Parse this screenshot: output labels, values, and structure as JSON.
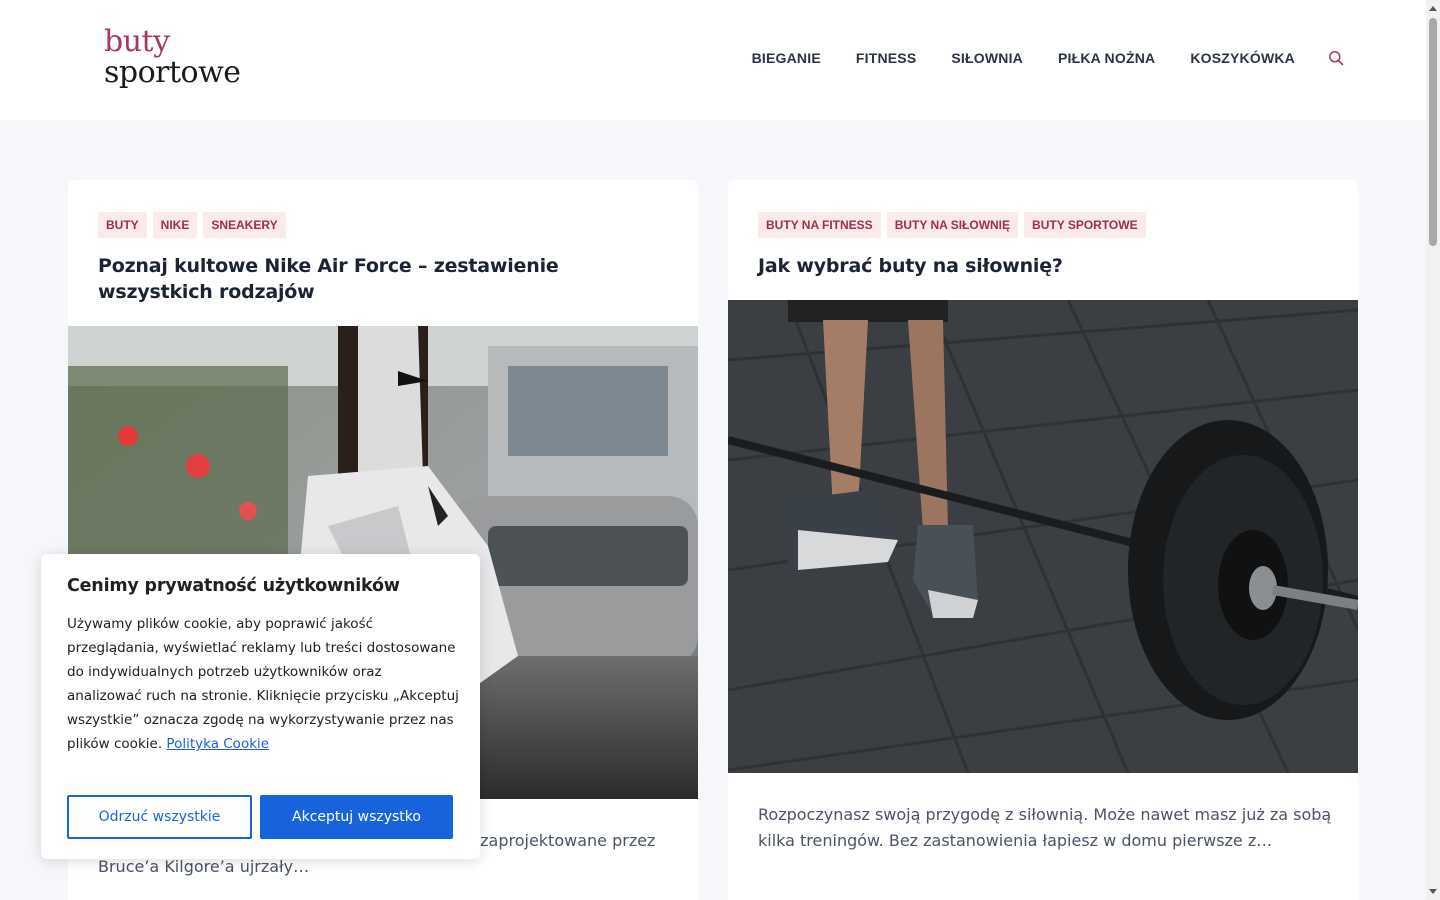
{
  "header": {
    "logo": {
      "line1": "buty",
      "line2": "sportowe"
    },
    "nav": [
      "BIEGANIE",
      "FITNESS",
      "SIŁOWNIA",
      "PIŁKA NOŻNA",
      "KOSZYKÓWKA"
    ],
    "search_icon": "search-icon"
  },
  "posts": [
    {
      "tags": [
        "BUTY",
        "NIKE",
        "SNEAKERY"
      ],
      "title": "Poznaj kultowe Nike Air Force – zestawienie wszystkich rodzajów",
      "excerpt": "…ów w całym dorobku ekipy z Beaverton. Buty zaprojektowane przez Bruce’a Kilgore’a ujrzały…"
    },
    {
      "tags": [
        "BUTY NA FITNESS",
        "BUTY NA SIŁOWNIĘ",
        "BUTY SPORTOWE"
      ],
      "title": "Jak wybrać buty na siłownię?",
      "excerpt": "Rozpoczynasz swoją przygodę z siłownią. Może nawet masz już za sobą kilka treningów. Bez zastanowienia łapiesz w domu pierwsze z…"
    }
  ],
  "cookie": {
    "title": "Cenimy prywatność użytkowników",
    "text": "Używamy plików cookie, aby poprawić jakość przeglądania, wyświetlać reklamy lub treści dostosowane do indywidualnych potrzeb użytkowników oraz analizować ruch na stronie. Kliknięcie przycisku „Akceptuj wszystkie” oznacza zgodę na wykorzystywanie przez nas plików cookie.",
    "policy_link": "Polityka Cookie",
    "reject_label": "Odrzuć wszystkie",
    "accept_label": "Akceptuj wszystko"
  },
  "colors": {
    "brand": "#a33a5f",
    "tag_bg": "#fbeaea",
    "tag_text": "#9e2f4c",
    "cookie_button": "#1863dc"
  }
}
